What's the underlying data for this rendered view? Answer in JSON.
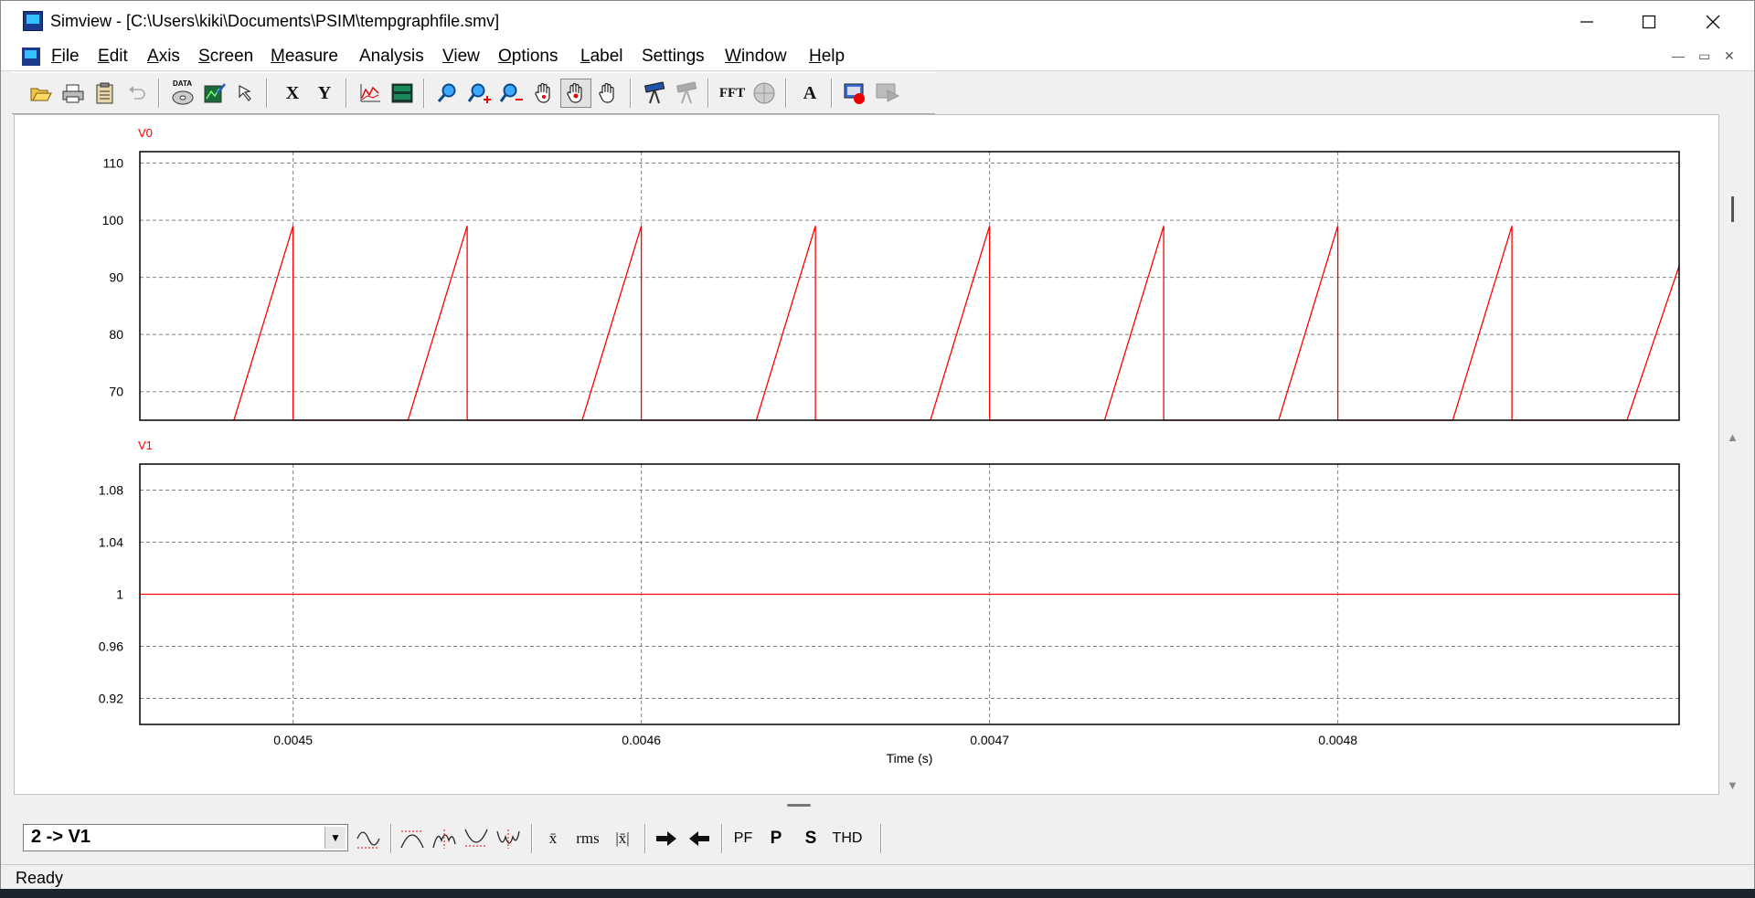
{
  "window": {
    "title": "Simview - [C:\\Users\\kiki\\Documents\\PSIM\\tempgraphfile.smv]",
    "controls": {
      "minimize": "—",
      "maximize": "☐",
      "close": "✕"
    }
  },
  "menu": [
    {
      "label": "File",
      "key": "F",
      "rest": "ile"
    },
    {
      "label": "Edit",
      "key": "E",
      "rest": "dit"
    },
    {
      "label": "Axis",
      "key": "A",
      "rest": "xis"
    },
    {
      "label": "Screen",
      "key": "S",
      "rest": "creen"
    },
    {
      "label": "Measure",
      "key": "M",
      "rest": "easure"
    },
    {
      "label": "Analysis",
      "key": "",
      "rest": "Analysis"
    },
    {
      "label": "View",
      "key": "V",
      "rest": "iew"
    },
    {
      "label": "Options",
      "key": "O",
      "rest": "ptions"
    },
    {
      "label": "Label",
      "key": "L",
      "rest": "abel"
    },
    {
      "label": "Settings",
      "key": "",
      "rest": "Settings"
    },
    {
      "label": "Window",
      "key": "W",
      "rest": "indow"
    },
    {
      "label": "Help",
      "key": "H",
      "rest": "elp"
    }
  ],
  "toolbar": {
    "data_label": "DATA",
    "x_label": "X",
    "y_label": "Y",
    "fft_label": "FFT",
    "text_label": "A"
  },
  "bottom_toolbar": {
    "curve_selected": "2 -> V1",
    "xbar_label": "x̄",
    "rms_label": "rms",
    "absavg_label": "|x̄|",
    "pf_label": "PF",
    "p_label": "P",
    "s_label": "S",
    "thd_label": "THD"
  },
  "status": {
    "text": "Ready"
  },
  "colors": {
    "trace": "#ff0000",
    "grid": "#808080",
    "frame": "#000000"
  },
  "chart_data": [
    {
      "type": "line",
      "title": "V0",
      "xlabel": "",
      "ylabel": "",
      "xlim": [
        0.004456,
        0.004898
      ],
      "ylim": [
        65,
        112
      ],
      "yticks": [
        70,
        80,
        90,
        100,
        110
      ],
      "ytick_labels": [
        "70",
        "80",
        "90",
        "100",
        "110"
      ],
      "xticks": [
        0.0045,
        0.0046,
        0.0047,
        0.0048
      ],
      "grid": true,
      "series": [
        {
          "name": "V0",
          "x": [
            0.004483,
            0.0045,
            0.0045,
            0.004533,
            0.00455,
            0.00455,
            0.004583,
            0.0046,
            0.0046,
            0.004633,
            0.00465,
            0.00465,
            0.004683,
            0.0047,
            0.0047,
            0.004733,
            0.00475,
            0.00475,
            0.004783,
            0.0048,
            0.0048,
            0.004833,
            0.00485,
            0.00485,
            0.004883,
            0.004898
          ],
          "y": [
            65,
            99,
            65,
            65,
            99,
            65,
            65,
            99,
            65,
            65,
            99,
            65,
            65,
            99,
            65,
            65,
            99,
            65,
            65,
            99,
            65,
            65,
            99,
            65,
            65,
            92
          ]
        }
      ]
    },
    {
      "type": "line",
      "title": "V1",
      "xlabel": "Time (s)",
      "ylabel": "",
      "xlim": [
        0.004456,
        0.004898
      ],
      "ylim": [
        0.9,
        1.1
      ],
      "yticks": [
        0.92,
        0.96,
        1.0,
        1.04,
        1.08
      ],
      "ytick_labels": [
        "0.92",
        "0.96",
        "1",
        "1.04",
        "1.08"
      ],
      "xticks": [
        0.0045,
        0.0046,
        0.0047,
        0.0048
      ],
      "xtick_labels": [
        "0.0045",
        "0.0046",
        "0.0047",
        "0.0048"
      ],
      "grid": true,
      "series": [
        {
          "name": "V1",
          "x": [
            0.004456,
            0.004898
          ],
          "y": [
            1,
            1
          ]
        }
      ]
    }
  ]
}
